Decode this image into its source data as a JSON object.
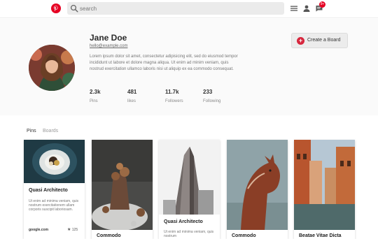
{
  "header": {
    "search_placeholder": "search",
    "notification_count": "9+",
    "icons": [
      "pinterest-logo-icon",
      "search-icon",
      "menu-icon",
      "user-icon",
      "message-icon"
    ]
  },
  "profile": {
    "name": "Jane Doe",
    "email": "hello@example.com",
    "bio": "Lorem ipsum dolor sit amet, consectetur adipisicing elit, sed do eiusmod tempor incididunt ut labore et dolore magna aliqua. Ut enim ad minim veniam, quis nostrud exercitation ullamco laboris nisi ut aliquip ex ea commodo consequat.",
    "stats": [
      {
        "value": "2.3k",
        "label": "Pins"
      },
      {
        "value": "481",
        "label": "likes"
      },
      {
        "value": "11.7k",
        "label": "Followers"
      },
      {
        "value": "233",
        "label": "Following"
      }
    ],
    "create_board_label": "Create a Board"
  },
  "tabs": [
    {
      "label": "Pins",
      "active": true
    },
    {
      "label": "Boards",
      "active": false
    }
  ],
  "cards": [
    {
      "title": "Quasi Architecto",
      "description": "Ut enim ad minima veniam, quis nostrum exercitationem ullam corporis suscipit laboriosam.",
      "source": "google.com",
      "likes": "125"
    },
    {
      "title": "Commodo",
      "description": "",
      "source": "",
      "likes": ""
    },
    {
      "title": "Quasi Architecto",
      "description": "Ut enim ad minima veniam, quis nostrum",
      "source": "",
      "likes": ""
    },
    {
      "title": "Commodo",
      "description": "",
      "source": "",
      "likes": ""
    },
    {
      "title": "Beatae Vitae Dicta",
      "description": "",
      "source": "",
      "likes": ""
    }
  ],
  "colors": {
    "brand": "#e60023",
    "create_button_icon": "#d7263d",
    "search_bg": "#ebebeb"
  }
}
